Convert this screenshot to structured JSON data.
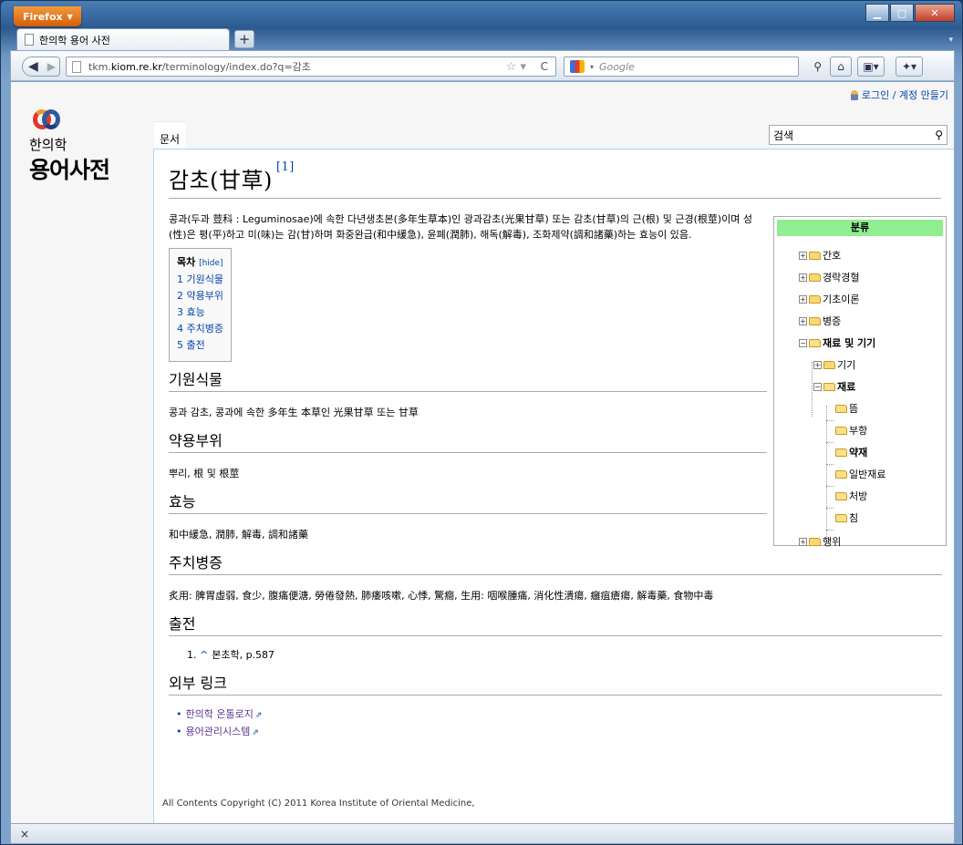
{
  "browser": {
    "app_button": "Firefox",
    "tab_title": "한의학 용어 사전",
    "new_tab": "+",
    "url_prefix": "tkm.",
    "url_domain": "kiom.re.kr",
    "url_path": "/terminology/index.do?q=감초",
    "search_placeholder": "Google",
    "status": "×"
  },
  "site": {
    "login": "로그인 / 계정 만들기",
    "logo_sub": "한의학",
    "logo_main": "용어사전",
    "tab_doc": "문서",
    "search_value": "검색",
    "footer": "All Contents Copyright (C) 2011 Korea Institute of Oriental Medicine,"
  },
  "article": {
    "title": "감초(甘草)",
    "title_ref": "[1]",
    "intro": "콩과(두과 荳科 : Leguminosae)에 속한 다년생초본(多年生草本)인 광과감초(光果甘草) 또는 감초(甘草)의 근(根) 및 근경(根莖)이며 성(性)은 평(平)하고 미(味)는 감(甘)하며 화중완급(和中緩急), 윤폐(潤肺), 해독(解毒), 조화제약(調和諸藥)하는 효능이 있음.",
    "toc_title": "목차",
    "toc_hide": "[hide]",
    "toc": [
      "1 기원식물",
      "2 약용부위",
      "3 효능",
      "4 주치병증",
      "5 출전"
    ],
    "sections": [
      {
        "heading": "기원식물",
        "text": "콩과 감초, 콩과에 속한 多年生 本草인 光果甘草 또는 甘草"
      },
      {
        "heading": "약용부위",
        "text": "뿌리, 根 및 根莖"
      },
      {
        "heading": "효능",
        "text": "和中緩急, 潤肺, 解毒, 調和諸藥"
      },
      {
        "heading": "주치병증",
        "text": "炙用: 脾胃虛弱, 食少, 腹痛便溏, 勞倦發熱, 肺痿咳嗽, 心悸, 驚癎, 生用: 咽喉腫痛, 消化性潰瘍, 癰疽瘡瘍, 解毒藥, 食物中毒"
      }
    ],
    "sources_heading": "출전",
    "source_item_num": "1.",
    "source_item_caret": "^",
    "source_item": "본초학, p.587",
    "external_heading": "외부 링크",
    "external_links": [
      "한의학 온톨로지",
      "용어관리시스템"
    ]
  },
  "category": {
    "title": "분류",
    "items": [
      {
        "label": "간호"
      },
      {
        "label": "경락경혈"
      },
      {
        "label": "기초이론"
      },
      {
        "label": "병증"
      },
      {
        "label": "재료 및 기기"
      },
      {
        "label": "기기"
      },
      {
        "label": "재료"
      },
      {
        "label": "뜸"
      },
      {
        "label": "부항"
      },
      {
        "label": "약재"
      },
      {
        "label": "일반재료"
      },
      {
        "label": "처방"
      },
      {
        "label": "침"
      },
      {
        "label": "행위"
      }
    ]
  }
}
